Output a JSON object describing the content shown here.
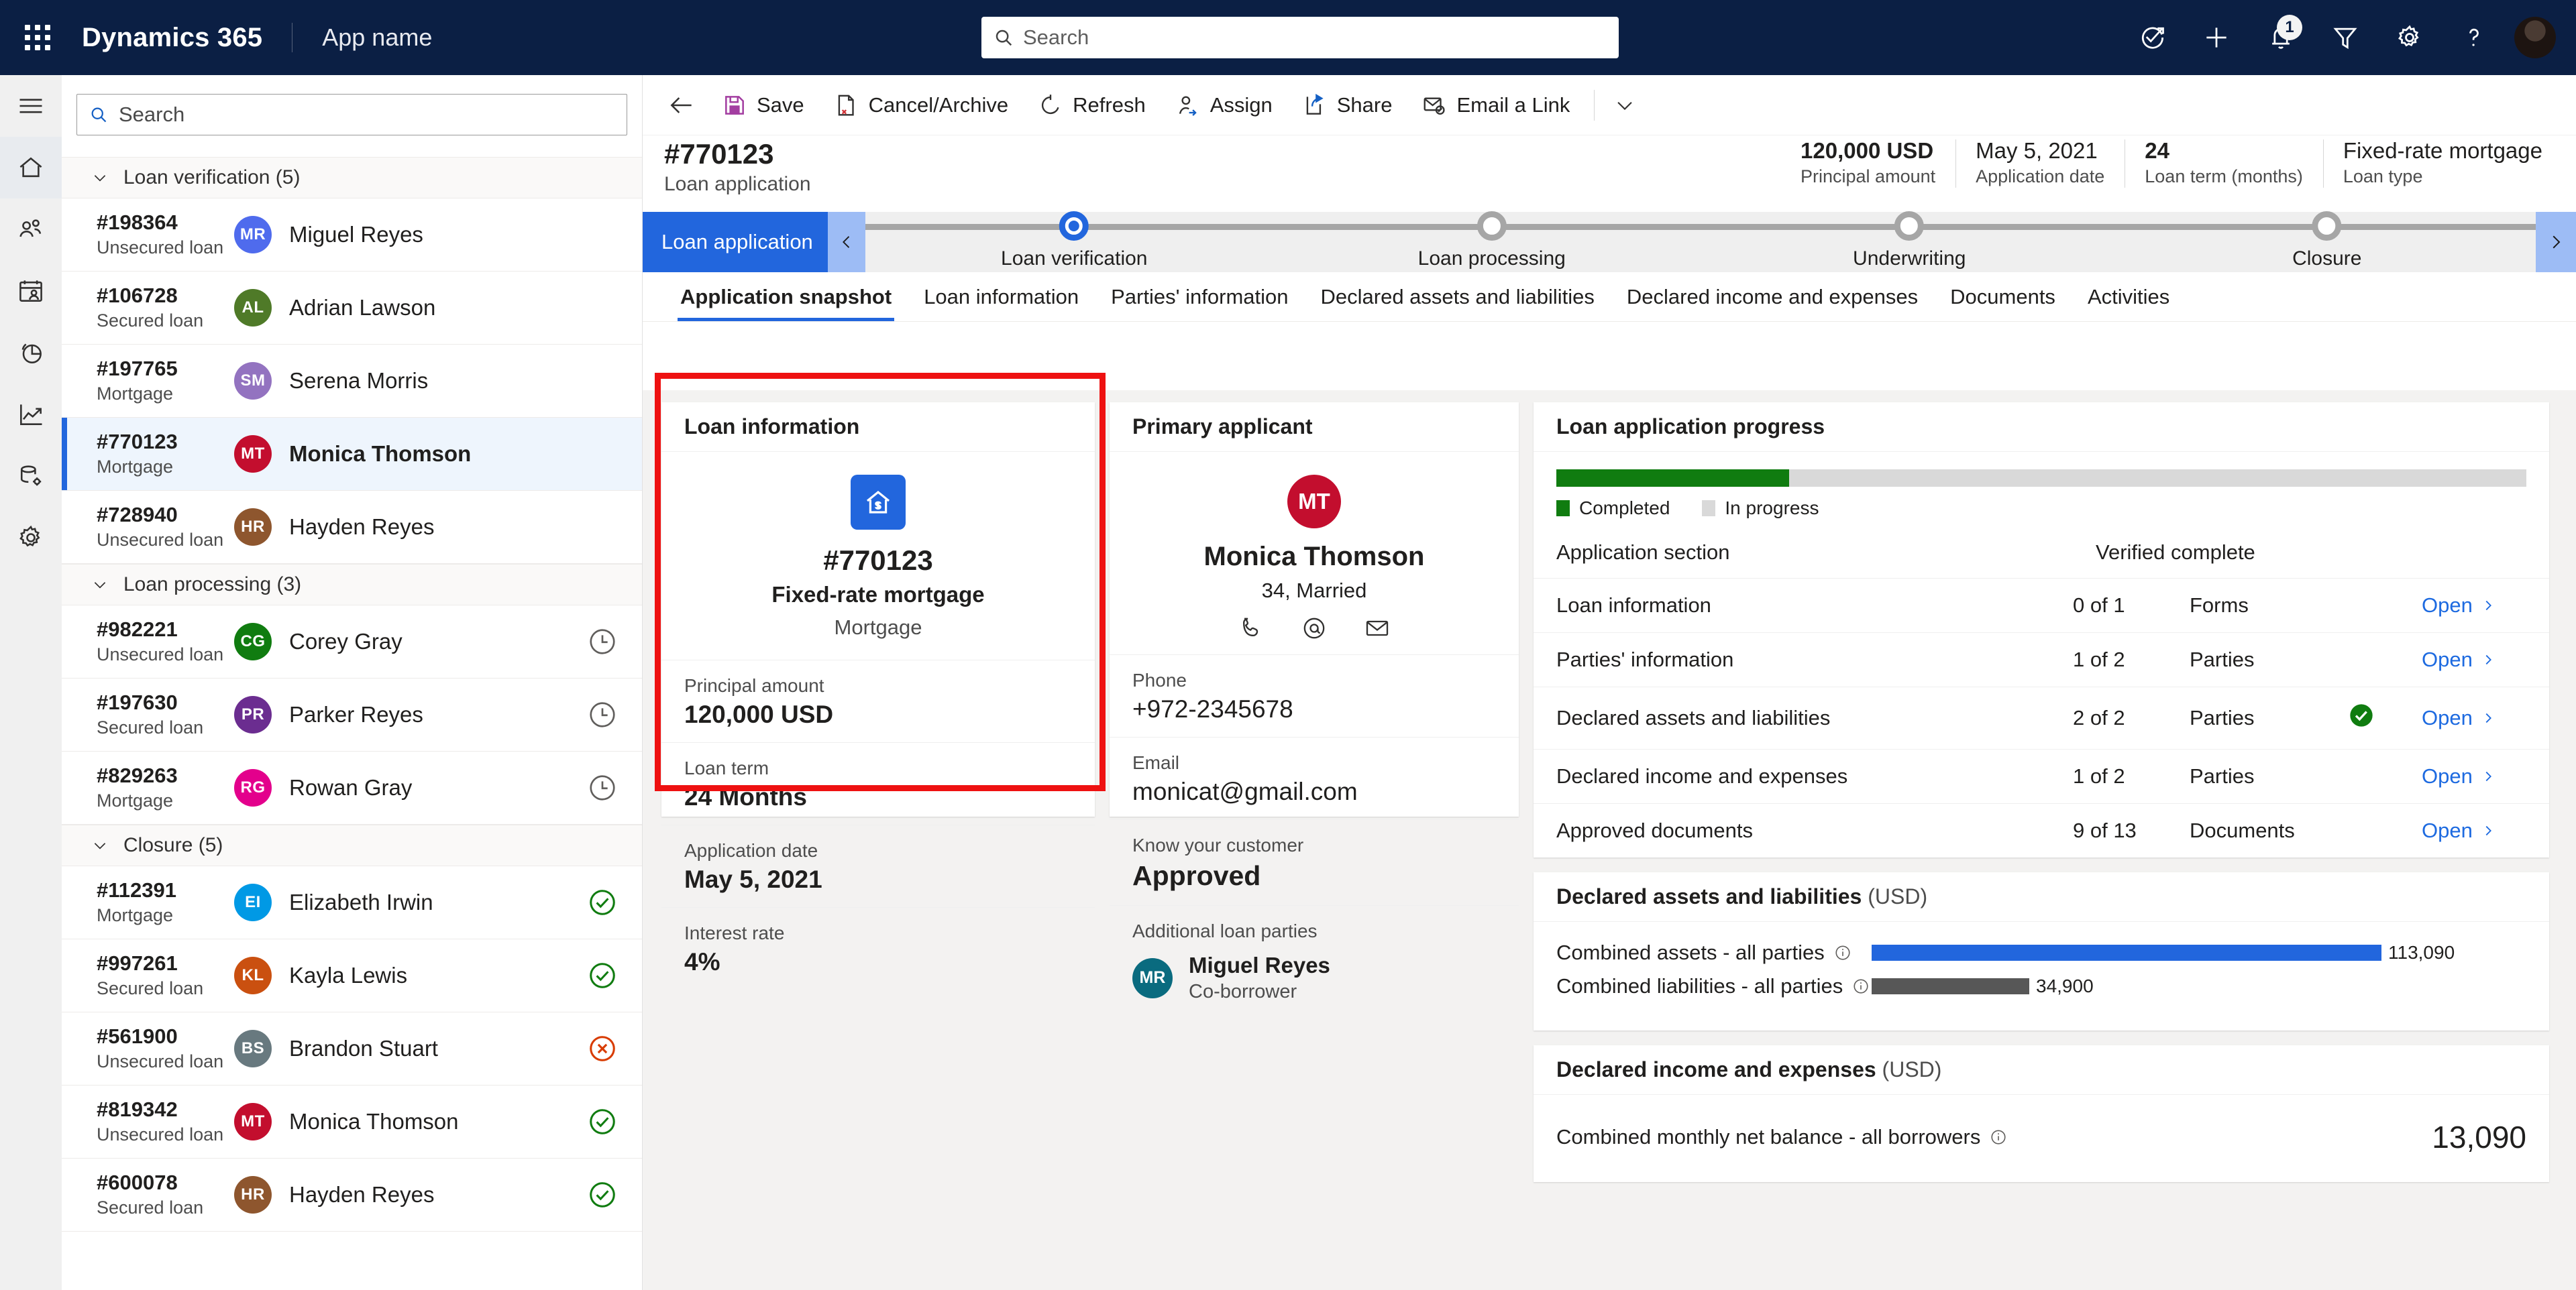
{
  "topbar": {
    "brand": "Dynamics 365",
    "app_name": "App name",
    "search_placeholder": "Search",
    "notification_count": "1",
    "icons": [
      "task-check-icon",
      "plus-icon",
      "bell-icon",
      "filter-icon",
      "gear-icon",
      "help-icon",
      "avatar"
    ]
  },
  "rail": {
    "items": [
      "hamburger-icon",
      "home-icon",
      "people-icon",
      "calendar-person-icon",
      "pie-chart-icon",
      "trend-chart-icon",
      "database-gear-icon",
      "settings-gear-icon"
    ]
  },
  "list_pane": {
    "search_placeholder": "Search",
    "groups": [
      {
        "label": "Loan verification (5)",
        "rows": [
          {
            "id": "#198364",
            "type": "Unsecured loan",
            "initials": "MR",
            "name": "Miguel Reyes",
            "color": "#4f6bed",
            "status": ""
          },
          {
            "id": "#106728",
            "type": "Secured loan",
            "initials": "AL",
            "name": "Adrian Lawson",
            "color": "#4f7a28",
            "status": ""
          },
          {
            "id": "#197765",
            "type": "Mortgage",
            "initials": "SM",
            "name": "Serena Morris",
            "color": "#9373c0",
            "status": ""
          },
          {
            "id": "#770123",
            "type": "Mortgage",
            "initials": "MT",
            "name": "Monica Thomson",
            "color": "#c30e2e",
            "status": "",
            "selected": true
          },
          {
            "id": "#728940",
            "type": "Unsecured loan",
            "initials": "HR",
            "name": "Hayden Reyes",
            "color": "#8e562e",
            "status": ""
          }
        ]
      },
      {
        "label": "Loan processing (3)",
        "rows": [
          {
            "id": "#982221",
            "type": "Unsecured loan",
            "initials": "CG",
            "name": "Corey Gray",
            "color": "#107c10",
            "status": "clock"
          },
          {
            "id": "#197630",
            "type": "Secured loan",
            "initials": "PR",
            "name": "Parker Reyes",
            "color": "#6b2d90",
            "status": "clock"
          },
          {
            "id": "#829263",
            "type": "Mortgage",
            "initials": "RG",
            "name": "Rowan Gray",
            "color": "#e3008c",
            "status": "clock"
          }
        ]
      },
      {
        "label": "Closure (5)",
        "rows": [
          {
            "id": "#112391",
            "type": "Mortgage",
            "initials": "EI",
            "name": "Elizabeth Irwin",
            "color": "#0099e5",
            "status": "check"
          },
          {
            "id": "#997261",
            "type": "Secured loan",
            "initials": "KL",
            "name": "Kayla Lewis",
            "color": "#ca5010",
            "status": "check"
          },
          {
            "id": "#561900",
            "type": "Unsecured loan",
            "initials": "BS",
            "name": "Brandon Stuart",
            "color": "#68797f",
            "status": "x"
          },
          {
            "id": "#819342",
            "type": "Unsecured loan",
            "initials": "MT",
            "name": "Monica Thomson",
            "color": "#c30e2e",
            "status": "check"
          },
          {
            "id": "#600078",
            "type": "Secured loan",
            "initials": "HR",
            "name": "Hayden Reyes",
            "color": "#8e562e",
            "status": "check"
          }
        ]
      }
    ]
  },
  "command_bar": {
    "back": "back-arrow",
    "items": [
      {
        "label": "Save",
        "icon": "save-icon"
      },
      {
        "label": "Cancel/Archive",
        "icon": "cancel-archive-icon"
      },
      {
        "label": "Refresh",
        "icon": "refresh-icon"
      },
      {
        "label": "Assign",
        "icon": "assign-icon"
      },
      {
        "label": "Share",
        "icon": "share-icon"
      },
      {
        "label": "Email a Link",
        "icon": "email-link-icon"
      }
    ],
    "overflow": "chevron-down-icon"
  },
  "record_header": {
    "title": "#770123",
    "subtitle": "Loan application",
    "fields": [
      {
        "value": "120,000 USD",
        "label": "Principal amount"
      },
      {
        "value": "May 5, 2021",
        "label": "Application date"
      },
      {
        "value": "24",
        "label": "Loan term (months)"
      },
      {
        "value": "Fixed-rate mortgage",
        "label": "Loan type"
      }
    ]
  },
  "process_flow": {
    "active_stage": "Loan application",
    "stages": [
      {
        "label": "Loan verification",
        "current": true
      },
      {
        "label": "Loan processing",
        "current": false
      },
      {
        "label": "Underwriting",
        "current": false
      },
      {
        "label": "Closure",
        "current": false
      }
    ]
  },
  "tabs": [
    {
      "label": "Application snapshot",
      "active": true
    },
    {
      "label": "Loan information",
      "active": false
    },
    {
      "label": "Parties' information",
      "active": false
    },
    {
      "label": "Declared assets and liabilities",
      "active": false
    },
    {
      "label": "Declared income and expenses",
      "active": false
    },
    {
      "label": "Documents",
      "active": false
    },
    {
      "label": "Activities",
      "active": false
    }
  ],
  "loan_info_card": {
    "title": "Loan information",
    "icon": "house-dollar-icon",
    "number": "#770123",
    "type": "Fixed-rate mortgage",
    "category": "Mortgage",
    "fields": [
      {
        "label": "Principal amount",
        "value": "120,000 USD"
      },
      {
        "label": "Loan term",
        "value": "24 Months"
      },
      {
        "label": "Application date",
        "value": "May 5, 2021"
      },
      {
        "label": "Interest rate",
        "value": "4%"
      }
    ]
  },
  "applicant_card": {
    "title": "Primary applicant",
    "initials": "MT",
    "avatar_color": "#c30e2e",
    "name": "Monica Thomson",
    "meta": "34, Married",
    "action_icons": [
      "phone-icon",
      "at-sign-icon",
      "envelope-icon"
    ],
    "fields": [
      {
        "label": "Phone",
        "value": "+972-2345678"
      },
      {
        "label": "Email",
        "value": "monicat@gmail.com"
      },
      {
        "label": "Know your customer",
        "value": "Approved"
      }
    ],
    "parties_label": "Additional loan parties",
    "parties": [
      {
        "initials": "MR",
        "name": "Miguel Reyes",
        "role": "Co-borrower",
        "color": "#0a6b7f"
      }
    ]
  },
  "progress_card": {
    "title": "Loan application progress",
    "completed_percent": 24,
    "legend": [
      {
        "label": "Completed",
        "color": "#107c10"
      },
      {
        "label": "In progress",
        "color": "#d9d9d9"
      }
    ],
    "columns": [
      "Application section",
      "Verified complete"
    ],
    "rows": [
      {
        "section": "Loan information",
        "count": "0 of 1",
        "unit": "Forms",
        "verified": false,
        "open": "Open"
      },
      {
        "section": "Parties' information",
        "count": "1 of 2",
        "unit": "Parties",
        "verified": false,
        "open": "Open"
      },
      {
        "section": "Declared assets and liabilities",
        "count": "2 of 2",
        "unit": "Parties",
        "verified": true,
        "open": "Open"
      },
      {
        "section": "Declared income and expenses",
        "count": "1 of 2",
        "unit": "Parties",
        "verified": false,
        "open": "Open"
      },
      {
        "section": "Approved documents",
        "count": "9 of 13",
        "unit": "Documents",
        "verified": false,
        "open": "Open"
      }
    ]
  },
  "assets_card": {
    "title": "Declared assets and liabilities",
    "unit": "(USD)",
    "rows": [
      {
        "label": "Combined assets - all parties",
        "value": "113,090",
        "amount": 113090,
        "color": "#2266dd"
      },
      {
        "label": "Combined liabilities - all parties",
        "value": "34,900",
        "amount": 34900,
        "color": "#575757"
      }
    ]
  },
  "income_card": {
    "title": "Declared income and expenses",
    "unit": "(USD)",
    "label": "Combined monthly net balance - all borrowers",
    "value": "13,090"
  },
  "chart_data": {
    "type": "bar",
    "title": "Declared assets and liabilities (USD)",
    "categories": [
      "Combined assets - all parties",
      "Combined liabilities - all parties"
    ],
    "values": [
      113090,
      34900
    ],
    "xlabel": "",
    "ylabel": "",
    "xlim": [
      0,
      125000
    ],
    "colors": [
      "#2266dd",
      "#575757"
    ],
    "orientation": "horizontal",
    "data_labels": [
      "113,090",
      "34,900"
    ]
  }
}
